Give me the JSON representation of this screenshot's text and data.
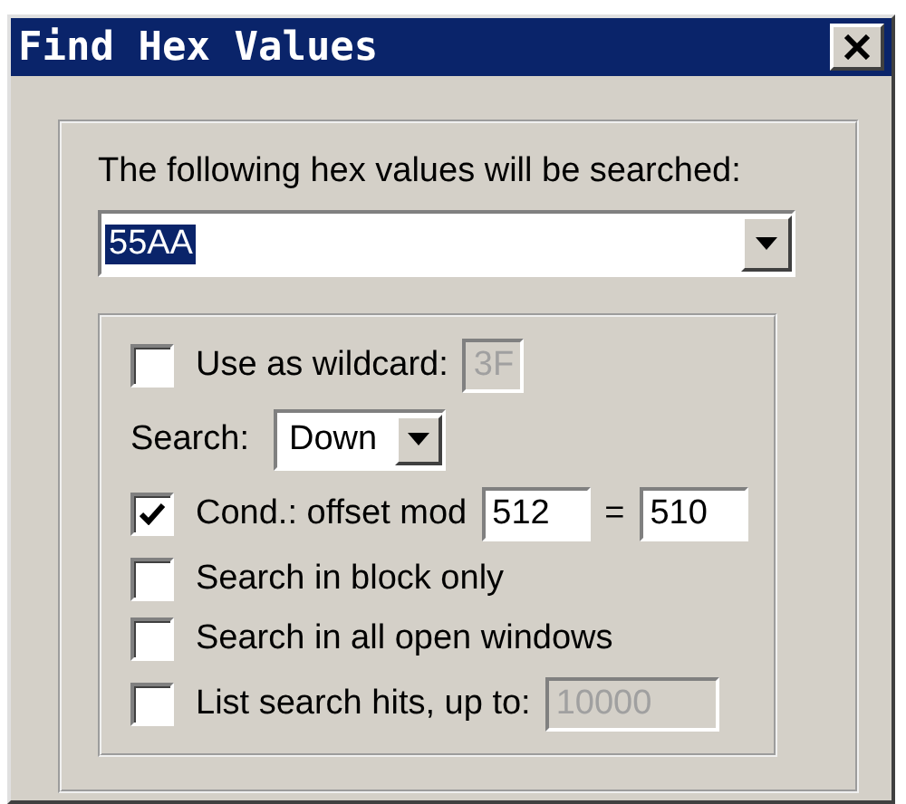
{
  "window": {
    "title": "Find Hex Values"
  },
  "prompt": "The following hex values will be searched:",
  "hex_input": {
    "value": "55AA",
    "selected": true
  },
  "options": [
    {
      "kind": "checkbox",
      "label": "Use as wildcard:",
      "checked": false,
      "fields": [
        {
          "value": "3F",
          "disabled": true
        }
      ]
    },
    {
      "kind": "dropdown",
      "label": "Search:",
      "value": "Down"
    },
    {
      "kind": "checkbox",
      "label": "Cond.: offset mod",
      "checked": true,
      "fields": [
        {
          "value": "512",
          "disabled": false
        },
        {
          "prefix": "=",
          "value": "510",
          "disabled": false
        }
      ]
    },
    {
      "kind": "checkbox",
      "label": "Search in block only",
      "checked": false
    },
    {
      "kind": "checkbox",
      "label": "Search in all open windows",
      "checked": false
    },
    {
      "kind": "checkbox",
      "label": "List search hits, up to:",
      "checked": false,
      "fields": [
        {
          "value": "10000",
          "disabled": true
        }
      ]
    }
  ]
}
